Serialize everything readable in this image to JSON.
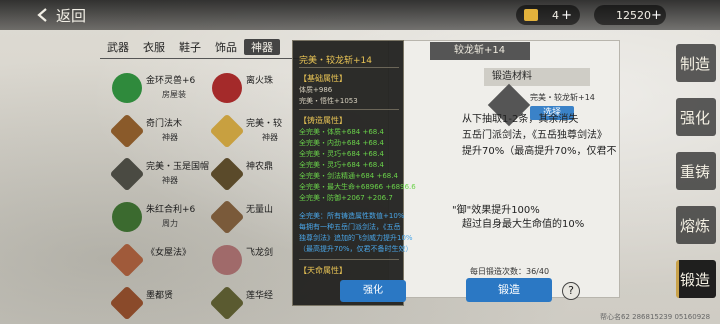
{
  "header": {
    "back_label": "返回",
    "gold_amount": "4",
    "silver_amount": "12520",
    "plus": "+"
  },
  "categories": [
    "武器",
    "衣服",
    "鞋子",
    "饰品",
    "神器"
  ],
  "active_category_index": 4,
  "items": [
    {
      "name": "金环灵兽+6",
      "sub": "房屋装",
      "tag": "",
      "color": "#2f8a3c"
    },
    {
      "name": "离火珠",
      "sub": "",
      "tag": "",
      "color": "#a42a2a"
    },
    {
      "name": "奇门法木",
      "sub": "神器",
      "tag": "",
      "color": "#8a5a2a"
    },
    {
      "name": "完美・较",
      "sub": "神器",
      "tag": "",
      "color": "#c8a040"
    },
    {
      "name": "完美・玉是国帽",
      "sub": "神器",
      "tag": "",
      "color": "#4a4a42"
    },
    {
      "name": "神农鼎",
      "sub": "",
      "tag": "",
      "color": "#5a4a2a"
    },
    {
      "name": "朱红合利+6",
      "sub": "周力",
      "tag": "",
      "color": "#3b6a2f"
    },
    {
      "name": "无量山",
      "sub": "",
      "tag": "",
      "color": "#7a5a3a"
    },
    {
      "name": "《女屋法》",
      "sub": "",
      "tag": "",
      "color": "#a05a3a"
    },
    {
      "name": "飞龙剑",
      "sub": "",
      "tag": "",
      "color": "#a06a6a"
    },
    {
      "name": "墨都贤",
      "sub": "",
      "tag": "",
      "color": "#8a4a2a"
    },
    {
      "name": "莲华经",
      "sub": "",
      "tag": "",
      "color": "#5a5a30"
    }
  ],
  "craft": {
    "title": "较龙斩+14",
    "materials_label": "锻造材料",
    "material_text": "完美・较龙斩+14",
    "select_label": "选择",
    "desc_lines": [
      "从下抽取1-2条，其余消失",
      "五岳门派剑法，《五岳独尊剑法》",
      "提升70%（最高提升70%，仅君不",
      ""
    ],
    "effect_lines": [
      "\"御\"效果提升100%",
      "超过自身最大生命值的10%"
    ],
    "daily_count": "每日锻造次数：36/40",
    "craft_button": "锻造",
    "help": "?"
  },
  "tooltip": {
    "title": "完美・较龙斩+14",
    "base_section": "【基础属性】",
    "base_lines": [
      "体质+986",
      "完美・悟性+1053"
    ],
    "forge_section": "【铸造属性】",
    "forge_lines": [
      "全完美・体质+684  +68.4",
      "全完美・内劲+684  +68.4",
      "全完美・灵巧+684  +68.4",
      "全完美・灵巧+684  +68.4",
      "全完美・剑法精通+684  +68.4",
      "全完美・最大生命+68966  +6896.6",
      "全完美・防御+2067  +206.7"
    ],
    "blue_lines": [
      "全完美：所有铸造属性数值+10%",
      "每拥有一种五岳门派剑法，《五岳",
      "独尊剑法》追加的飞剑威力提升10%",
      "（最高提升70%，仅君不备时生效）"
    ],
    "skill_section": "【天命属性】",
    "refine_button": "强化"
  },
  "side_tabs": [
    "制造",
    "强化",
    "重铸",
    "熔炼",
    "锻造"
  ],
  "active_side_tab_index": 4,
  "footer_id": "帮心名62 286815239 05160928"
}
